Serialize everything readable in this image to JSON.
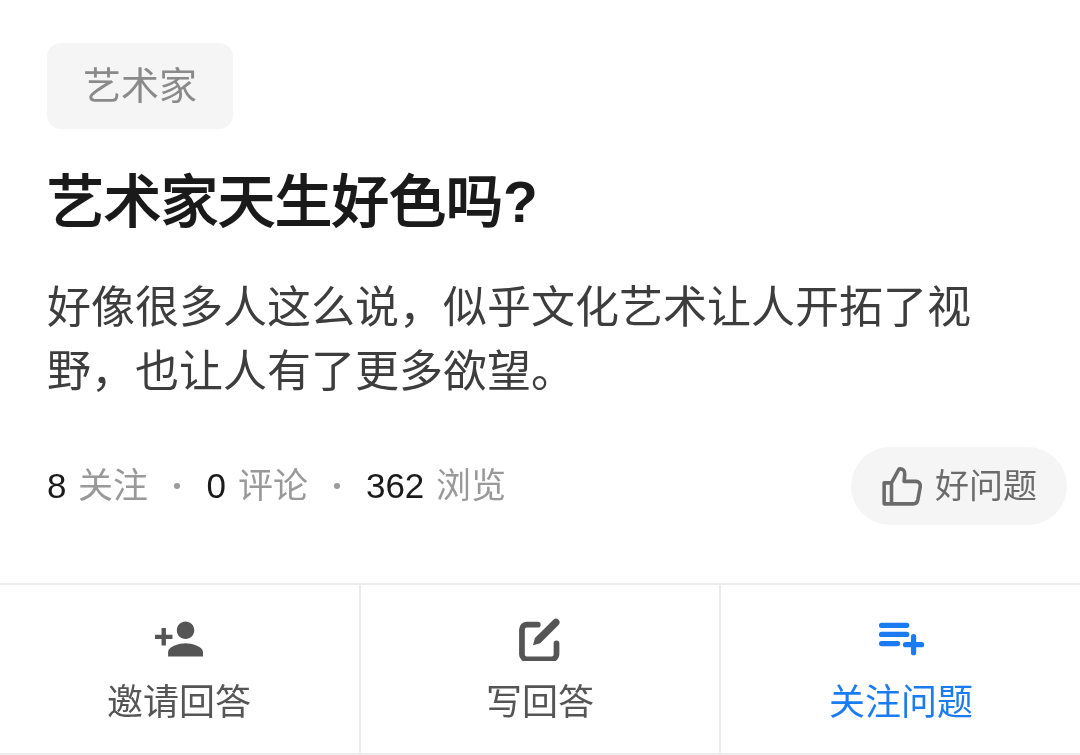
{
  "tag": {
    "label": "艺术家"
  },
  "question": {
    "title": "艺术家天生好色吗?",
    "description": "好像很多人这么说，似乎文化艺术让人开拓了视野，也让人有了更多欲望。"
  },
  "stats": [
    {
      "count": "8",
      "label": "关注"
    },
    {
      "count": "0",
      "label": "评论"
    },
    {
      "count": "362",
      "label": "浏览"
    }
  ],
  "good_question_button": {
    "label": "好问题"
  },
  "actions": [
    {
      "label": "邀请回答",
      "highlighted": false
    },
    {
      "label": "写回答",
      "highlighted": false
    },
    {
      "label": "关注问题",
      "highlighted": true
    }
  ]
}
